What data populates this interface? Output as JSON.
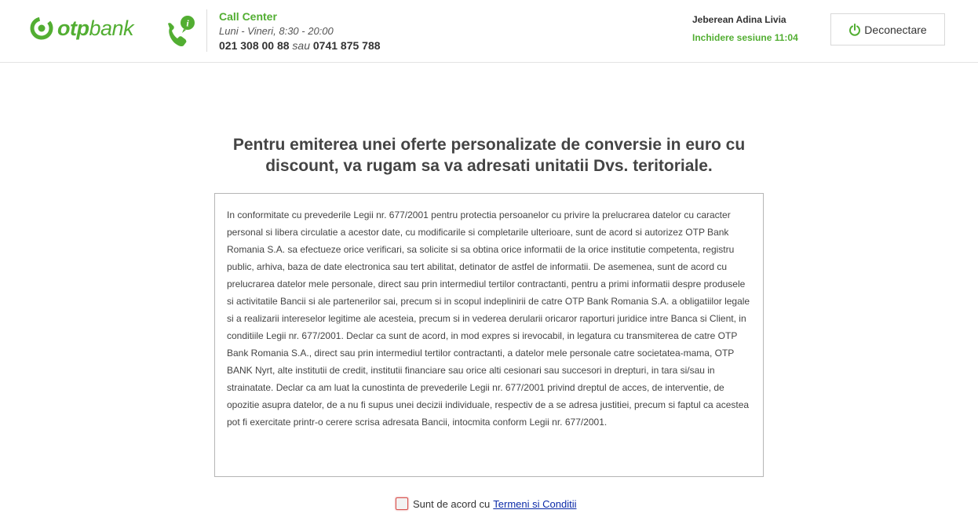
{
  "header": {
    "logo": {
      "otp": "otp",
      "bank": "bank"
    },
    "call_center": {
      "title": "Call Center",
      "hours": "Luni - Vineri, 8:30 - 20:00",
      "phone1": "021 308 00 88",
      "sep": "sau",
      "phone2": "0741 875 788"
    },
    "user": {
      "name": "Jeberean Adina Livia",
      "session": "Inchidere sesiune 11:04"
    },
    "logout_label": "Deconectare"
  },
  "main": {
    "title": "Pentru emiterea unei oferte personalizate de conversie in euro cu discount, va rugam sa va adresati unitatii Dvs. teritoriale.",
    "terms_text": "In conformitate cu prevederile Legii nr. 677/2001 pentru protectia persoanelor cu privire la prelucrarea datelor cu caracter personal si libera circulatie a acestor date, cu modificarile si completarile ulterioare, sunt de acord si autorizez OTP Bank Romania S.A. sa efectueze orice verificari, sa solicite si sa obtina orice informatii de la orice institutie competenta, registru public, arhiva, baza de date electronica sau tert abilitat, detinator de astfel de informatii. De asemenea, sunt de acord cu prelucrarea datelor mele personale, direct sau prin intermediul tertilor contractanti, pentru a primi informatii despre produsele si activitatile Bancii si ale partenerilor sai, precum si in scopul indeplinirii de catre OTP Bank Romania S.A. a obligatiilor legale si a realizarii intereselor legitime ale acesteia, precum si in vederea derularii oricaror raporturi juridice intre Banca si Client, in conditiile Legii nr. 677/2001. Declar ca sunt de acord, in mod expres si irevocabil, in legatura cu transmiterea de catre OTP Bank Romania S.A., direct sau prin intermediul tertilor contractanti, a datelor mele personale catre societatea-mama, OTP BANK Nyrt, alte institutii de credit, institutii financiare sau orice alti cesionari sau succesori in drepturi, in tara si/sau in strainatate. Declar ca am luat la cunostinta de prevederile Legii nr. 677/2001 privind dreptul de acces, de interventie, de opozitie asupra datelor, de a nu fi supus unei decizii individuale, respectiv de a se adresa justitiei, precum si faptul ca acestea pot fi exercitate printr-o cerere scrisa adresata Bancii, intocmita conform Legii nr. 677/2001.",
    "agree_label": "Sunt de acord cu",
    "terms_link": "Termeni si Conditii",
    "agree_checked": false
  },
  "colors": {
    "brand_green": "#52ae32",
    "checkbox_error": "#d9534f",
    "link": "#0b2aa8"
  },
  "icons": [
    "otp-logo-icon",
    "phone-info-icon",
    "power-icon"
  ]
}
